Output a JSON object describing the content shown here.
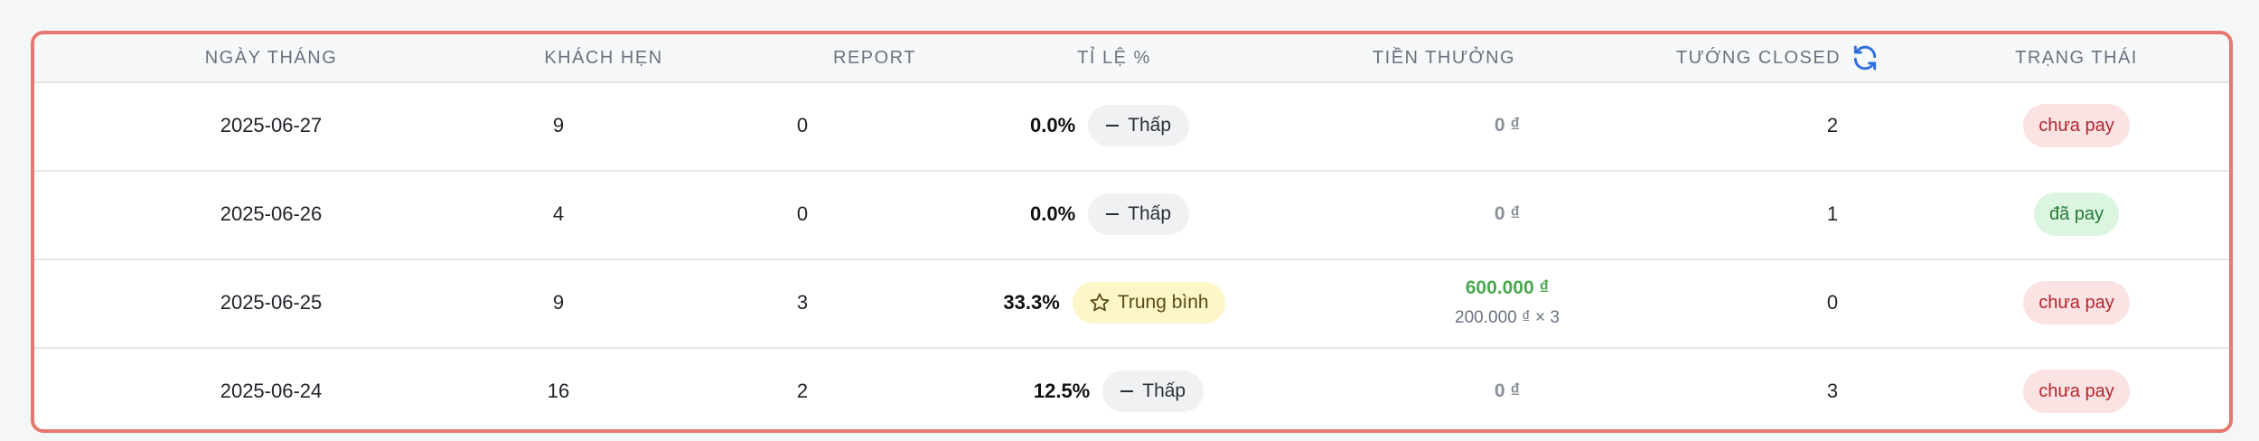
{
  "table": {
    "headers": {
      "date": "NGÀY THÁNG",
      "appointments": "KHÁCH HẸN",
      "report": "REPORT",
      "rate": "TỈ LỆ %",
      "bonus": "TIỀN THƯỞNG",
      "closed": "TƯỚNG CLOSED",
      "status": "TRẠNG THÁI"
    },
    "rows": [
      {
        "date": "2025-06-27",
        "appointments": "9",
        "report": "0",
        "rate": "0.0%",
        "level": "Thấp",
        "bonus": "0 ₫",
        "closed": "2",
        "status": "chưa pay"
      },
      {
        "date": "2025-06-26",
        "appointments": "4",
        "report": "0",
        "rate": "0.0%",
        "level": "Thấp",
        "bonus": "0 ₫",
        "closed": "1",
        "status": "đã pay"
      },
      {
        "date": "2025-06-25",
        "appointments": "9",
        "report": "3",
        "rate": "33.3%",
        "level": "Trung bình",
        "bonus": "600.000 ₫",
        "bonus_detail": "200.000 ₫ × 3",
        "closed": "0",
        "status": "chưa pay"
      },
      {
        "date": "2025-06-24",
        "appointments": "16",
        "report": "2",
        "rate": "12.5%",
        "level": "Thấp",
        "bonus": "0 ₫",
        "closed": "3",
        "status": "chưa pay"
      }
    ]
  },
  "icons": {
    "sync": "refresh-icon",
    "low_level": "minus-icon",
    "medium_level": "star-outline-icon"
  },
  "colors": {
    "card_border": "#e8776f",
    "bonus_positive": "#4aa84f",
    "status_unpaid_bg": "#fbe3e3",
    "status_paid_bg": "#dcf5e1",
    "medium_badge_bg": "#fdf6c8",
    "sync_icon": "#2f6fe0"
  }
}
